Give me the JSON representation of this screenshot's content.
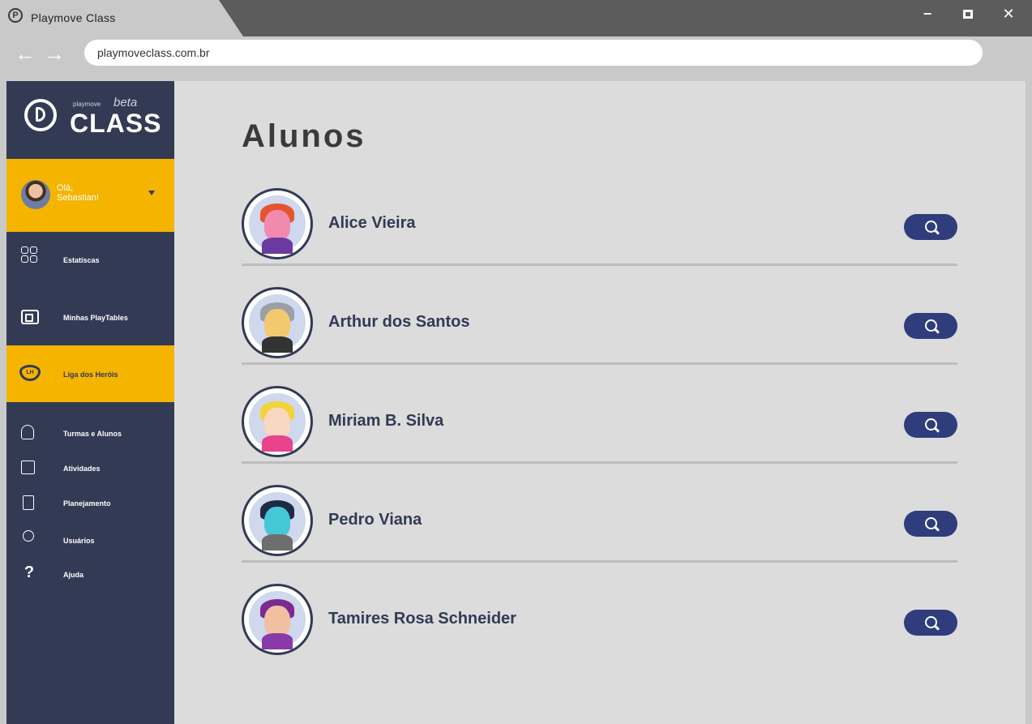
{
  "window": {
    "tab_title": "Playmove Class",
    "url": "playmoveclass.com.br",
    "controls": {
      "minimize": "−",
      "close": "✕"
    }
  },
  "nav": {
    "back": "←",
    "forward": "→"
  },
  "sidebar": {
    "brand_small": "playmove",
    "brand_beta": "beta",
    "brand_name": "CLASS",
    "user_greeting": "Olá, Sebastian!",
    "items": [
      {
        "label": "Estatíscas",
        "icon": "grid-icon",
        "active": false
      },
      {
        "label": "Minhas PlayTables",
        "icon": "screen-icon",
        "active": false
      },
      {
        "label": "Liga dos Heróis",
        "icon": "shield-icon",
        "badge": "LH",
        "active": true
      },
      {
        "label": "Turmas e Alunos",
        "icon": "users-icon",
        "active": false
      },
      {
        "label": "Atividades",
        "icon": "edit-icon",
        "active": false
      },
      {
        "label": "Planejamento",
        "icon": "clipboard-icon",
        "active": false
      },
      {
        "label": "Usuários",
        "icon": "user-icon",
        "active": false
      },
      {
        "label": "Ajuda",
        "icon": "question-icon",
        "glyph": "?",
        "active": false
      }
    ]
  },
  "main": {
    "title": "Alunos",
    "students": [
      {
        "name": "Alice Vieira",
        "avatar_hair": "#e5552b",
        "avatar_face": "#f28ab0",
        "avatar_body": "#6b3aa0"
      },
      {
        "name": "Arthur dos Santos",
        "avatar_hair": "#9aa0a8",
        "avatar_face": "#f2c96e",
        "avatar_body": "#333333"
      },
      {
        "name": "Miriam B. Silva",
        "avatar_hair": "#f3d23b",
        "avatar_face": "#f8d8c0",
        "avatar_body": "#e8448c"
      },
      {
        "name": "Pedro Viana",
        "avatar_hair": "#1f2a44",
        "avatar_face": "#45c7d8",
        "avatar_body": "#6e6e6e"
      },
      {
        "name": "Tamires Rosa Schneider",
        "avatar_hair": "#7a2a90",
        "avatar_face": "#f0c0a0",
        "avatar_body": "#8a3aa8"
      }
    ]
  },
  "colors": {
    "sidebar_bg": "#323a54",
    "accent_yellow": "#f4b400",
    "search_button": "#2f3d7d",
    "content_bg": "#dcdcdc"
  }
}
